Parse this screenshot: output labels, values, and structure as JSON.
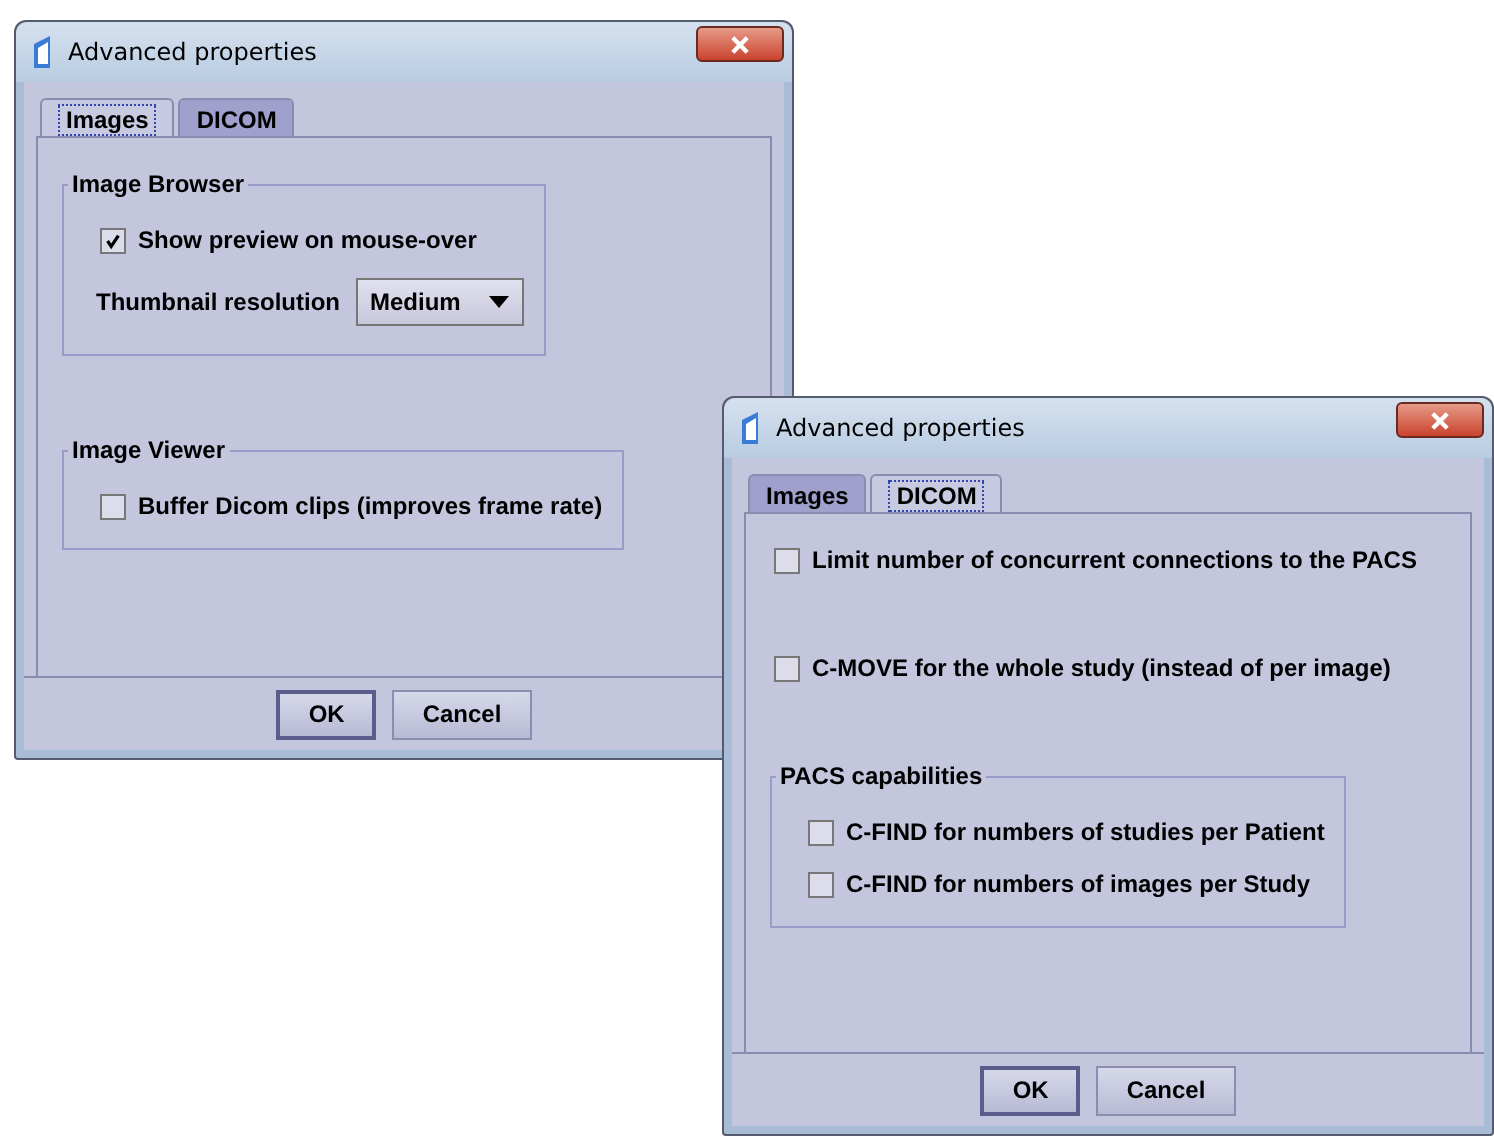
{
  "windows": [
    {
      "title": "Advanced properties",
      "tabs": [
        {
          "label": "Images",
          "selected": true
        },
        {
          "label": "DICOM",
          "selected": false
        }
      ],
      "items": [
        {
          "kind": "group",
          "legend": "Image Browser",
          "children": [
            {
              "kind": "checkbox",
              "label": "Show preview on mouse-over",
              "checked": true
            },
            {
              "kind": "dropdown",
              "label": "Thumbnail resolution",
              "value": "Medium"
            }
          ]
        },
        {
          "kind": "group",
          "legend": "Image Viewer",
          "children": [
            {
              "kind": "checkbox",
              "label": "Buffer Dicom clips (improves frame rate)",
              "checked": false
            }
          ]
        }
      ],
      "buttons": [
        "OK",
        "Cancel"
      ]
    },
    {
      "title": "Advanced properties",
      "tabs": [
        {
          "label": "Images",
          "selected": false
        },
        {
          "label": "DICOM",
          "selected": true
        }
      ],
      "items": [
        {
          "kind": "checkbox",
          "label": "Limit number of concurrent connections to the PACS",
          "checked": false
        },
        {
          "kind": "checkbox",
          "label": "C-MOVE for the whole study (instead of per image)",
          "checked": false
        },
        {
          "kind": "group",
          "legend": "PACS capabilities",
          "children": [
            {
              "kind": "checkbox",
              "label": "C-FIND for numbers of studies per Patient",
              "checked": false
            },
            {
              "kind": "checkbox",
              "label": "C-FIND for numbers of images per Study",
              "checked": false
            }
          ]
        }
      ],
      "buttons": [
        "OK",
        "Cancel"
      ]
    }
  ]
}
